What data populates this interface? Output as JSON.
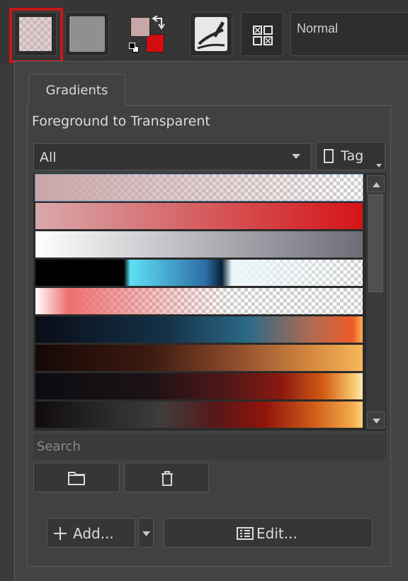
{
  "toolbar": {
    "mode_value": "Normal",
    "icons": [
      "gradient-preview",
      "pattern-preview",
      "fg-bg-colors",
      "brush-preset-icon",
      "grid-icon"
    ],
    "fg_color": "#c9a6a8",
    "bg_color": "#d20d10"
  },
  "popup": {
    "tab_label": "Gradients",
    "current_gradient": "Foreground to Transparent",
    "tag_filter": "All",
    "tag_button": "Tag",
    "search_placeholder": "Search",
    "add_label": "Add...",
    "edit_label": "Edit..."
  },
  "gradients": [
    {
      "name": "fg-to-transparent",
      "css": "linear-gradient(90deg, rgba(201,166,168,1), rgba(201,166,168,0))",
      "checker": true
    },
    {
      "name": "fg-to-bg",
      "css": "linear-gradient(90deg, #d8a9ab, #d41418)",
      "checker": false
    },
    {
      "name": "white-to-slate",
      "css": "linear-gradient(90deg, #ffffff, #6c6d78)",
      "checker": false
    },
    {
      "name": "black-cyan-white",
      "css": "linear-gradient(90deg, #000 0%, #000 27%, #5fe0f6 29%, #2d6ea6 52%, #0a2238 57%, #ecf6f8 60%, rgba(255,255,255,0) 100%)",
      "checker": true
    },
    {
      "name": "white-red-transparent",
      "css": "linear-gradient(90deg, #ffffff 0%, #ef6f6f 10%, rgba(235,90,90,0.3) 40%, rgba(235,90,90,0) 60%)",
      "checker": true
    },
    {
      "name": "dark-blue-orange",
      "css": "linear-gradient(90deg, #0a0d16 0%, #143148 40%, #2c6a86 65%, #b46a50 85%, #ed5b2a 97%, #fcb050 100%)",
      "checker": false
    },
    {
      "name": "brown-orange",
      "css": "linear-gradient(90deg, #160806 0%, #3c1a10 35%, #8a4a2c 60%, #d78a40 85%, #f7b85a 100%)",
      "checker": false
    },
    {
      "name": "dark-red-sun",
      "css": "linear-gradient(90deg, #0b0c10 0%, #1c1216 35%, #541818 60%, #8a1810 75%, #d45c14 88%, #f7c46a 97%, #ffe8b8 100%)",
      "checker": false
    },
    {
      "name": "grey-red-orange",
      "css": "linear-gradient(90deg, #100c0c 0%, #3e3d3d 38%, #581818 55%, #90130b 70%, #d05c1a 85%, #f4ac4a 97%, #ffcf80 100%)",
      "checker": false
    }
  ]
}
